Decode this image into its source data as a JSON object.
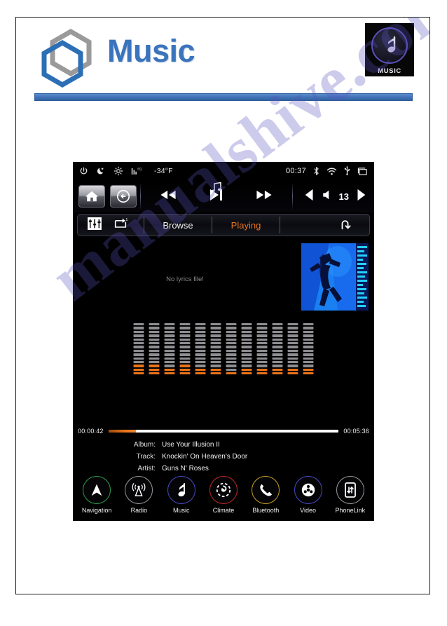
{
  "document": {
    "title": "Music",
    "watermark": "manualshive.com",
    "logo_blue": "#2C6FB5",
    "logo_gray": "#9A9A9A",
    "title_color": "#3b74bd",
    "rule_color": "#3f71b6"
  },
  "app_tile": {
    "label": "MUSIC",
    "icon": "music-note-icon",
    "ring_color": "#5a4fb8"
  },
  "screen": {
    "statusbar": {
      "power_icon": "power-icon",
      "night_icon": "moon-icon",
      "brightness_icon": "brightness-icon",
      "eq_icon": "eq-bars-icon",
      "temperature": "-34°F",
      "clock": "00:37",
      "bluetooth_icon": "bluetooth-icon",
      "wifi_icon": "wifi-icon",
      "usb_icon": "usb-icon",
      "window_icon": "window-icon"
    },
    "toprow": {
      "home_icon": "home-icon",
      "back_icon": "back-arrow-icon",
      "source_icon": "music-note-icon",
      "prev_icon": "previous-track-icon",
      "playpause_icon": "play-pause-icon",
      "next_icon": "next-track-icon",
      "vol_down_icon": "volume-down-icon",
      "speaker_icon": "speaker-icon",
      "volume_level": "13",
      "vol_up_icon": "volume-up-icon"
    },
    "tabs": {
      "eq_icon": "equalizer-icon",
      "repeat_icon": "repeat-one-icon",
      "browse_label": "Browse",
      "playing_label": "Playing",
      "active_tab": "Playing",
      "active_color": "#e8761c",
      "back_icon": "return-arrow-icon"
    },
    "nowplaying": {
      "lyrics_message": "No lyrics file!",
      "album_art_alt": "Use Your Illusion II album cover",
      "elapsed": "00:00:42",
      "duration": "00:05:36",
      "progress_percent": 12,
      "progress_color": "#e8731b",
      "meta": [
        {
          "key": "Album:",
          "value": "Use Your Illusion II"
        },
        {
          "key": "Track:",
          "value": "Knockin' On Heaven's Door"
        },
        {
          "key": "Artist:",
          "value": "Guns N' Roses"
        }
      ],
      "equalizer": {
        "columns": 12,
        "segments_per_column": 14,
        "gray_color": "#8d8d92",
        "orange_color": "#e8731b",
        "orange_levels": [
          3,
          3,
          2,
          3,
          2,
          2,
          1,
          2,
          2,
          2,
          2,
          2
        ]
      }
    },
    "transport": {
      "prev_icon": "previous-track-icon",
      "pause_icon": "pause-icon",
      "next_icon": "next-track-icon"
    },
    "dock": [
      {
        "label": "Navigation",
        "icon": "navigation-arrow-icon",
        "ring": "#2f9e4f"
      },
      {
        "label": "Radio",
        "icon": "radio-tower-icon",
        "ring": "#9a9a9a"
      },
      {
        "label": "Music",
        "icon": "music-note-icon",
        "ring": "#4a4ac8"
      },
      {
        "label": "Climate",
        "icon": "climate-fan-icon",
        "ring": "#c42828"
      },
      {
        "label": "Bluetooth",
        "icon": "phone-handset-icon",
        "ring": "#c8a02a"
      },
      {
        "label": "Video",
        "icon": "film-reel-icon",
        "ring": "#4a4ac8"
      },
      {
        "label": "PhoneLink",
        "icon": "phone-link-icon",
        "ring": "#9a9a9a"
      }
    ]
  }
}
